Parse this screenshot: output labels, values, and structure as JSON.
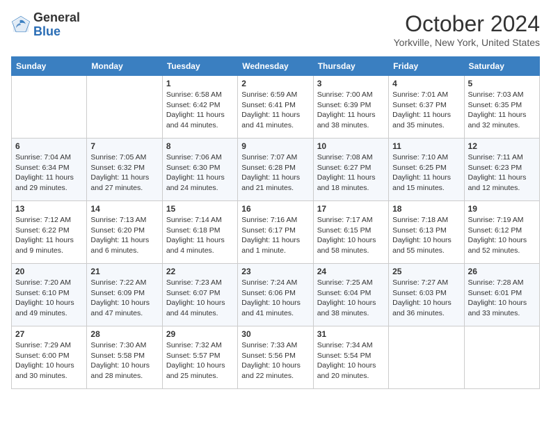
{
  "header": {
    "logo_general": "General",
    "logo_blue": "Blue",
    "month_year": "October 2024",
    "location": "Yorkville, New York, United States"
  },
  "days_of_week": [
    "Sunday",
    "Monday",
    "Tuesday",
    "Wednesday",
    "Thursday",
    "Friday",
    "Saturday"
  ],
  "weeks": [
    [
      {
        "day": "",
        "info": ""
      },
      {
        "day": "",
        "info": ""
      },
      {
        "day": "1",
        "info": "Sunrise: 6:58 AM\nSunset: 6:42 PM\nDaylight: 11 hours and 44 minutes."
      },
      {
        "day": "2",
        "info": "Sunrise: 6:59 AM\nSunset: 6:41 PM\nDaylight: 11 hours and 41 minutes."
      },
      {
        "day": "3",
        "info": "Sunrise: 7:00 AM\nSunset: 6:39 PM\nDaylight: 11 hours and 38 minutes."
      },
      {
        "day": "4",
        "info": "Sunrise: 7:01 AM\nSunset: 6:37 PM\nDaylight: 11 hours and 35 minutes."
      },
      {
        "day": "5",
        "info": "Sunrise: 7:03 AM\nSunset: 6:35 PM\nDaylight: 11 hours and 32 minutes."
      }
    ],
    [
      {
        "day": "6",
        "info": "Sunrise: 7:04 AM\nSunset: 6:34 PM\nDaylight: 11 hours and 29 minutes."
      },
      {
        "day": "7",
        "info": "Sunrise: 7:05 AM\nSunset: 6:32 PM\nDaylight: 11 hours and 27 minutes."
      },
      {
        "day": "8",
        "info": "Sunrise: 7:06 AM\nSunset: 6:30 PM\nDaylight: 11 hours and 24 minutes."
      },
      {
        "day": "9",
        "info": "Sunrise: 7:07 AM\nSunset: 6:28 PM\nDaylight: 11 hours and 21 minutes."
      },
      {
        "day": "10",
        "info": "Sunrise: 7:08 AM\nSunset: 6:27 PM\nDaylight: 11 hours and 18 minutes."
      },
      {
        "day": "11",
        "info": "Sunrise: 7:10 AM\nSunset: 6:25 PM\nDaylight: 11 hours and 15 minutes."
      },
      {
        "day": "12",
        "info": "Sunrise: 7:11 AM\nSunset: 6:23 PM\nDaylight: 11 hours and 12 minutes."
      }
    ],
    [
      {
        "day": "13",
        "info": "Sunrise: 7:12 AM\nSunset: 6:22 PM\nDaylight: 11 hours and 9 minutes."
      },
      {
        "day": "14",
        "info": "Sunrise: 7:13 AM\nSunset: 6:20 PM\nDaylight: 11 hours and 6 minutes."
      },
      {
        "day": "15",
        "info": "Sunrise: 7:14 AM\nSunset: 6:18 PM\nDaylight: 11 hours and 4 minutes."
      },
      {
        "day": "16",
        "info": "Sunrise: 7:16 AM\nSunset: 6:17 PM\nDaylight: 11 hours and 1 minute."
      },
      {
        "day": "17",
        "info": "Sunrise: 7:17 AM\nSunset: 6:15 PM\nDaylight: 10 hours and 58 minutes."
      },
      {
        "day": "18",
        "info": "Sunrise: 7:18 AM\nSunset: 6:13 PM\nDaylight: 10 hours and 55 minutes."
      },
      {
        "day": "19",
        "info": "Sunrise: 7:19 AM\nSunset: 6:12 PM\nDaylight: 10 hours and 52 minutes."
      }
    ],
    [
      {
        "day": "20",
        "info": "Sunrise: 7:20 AM\nSunset: 6:10 PM\nDaylight: 10 hours and 49 minutes."
      },
      {
        "day": "21",
        "info": "Sunrise: 7:22 AM\nSunset: 6:09 PM\nDaylight: 10 hours and 47 minutes."
      },
      {
        "day": "22",
        "info": "Sunrise: 7:23 AM\nSunset: 6:07 PM\nDaylight: 10 hours and 44 minutes."
      },
      {
        "day": "23",
        "info": "Sunrise: 7:24 AM\nSunset: 6:06 PM\nDaylight: 10 hours and 41 minutes."
      },
      {
        "day": "24",
        "info": "Sunrise: 7:25 AM\nSunset: 6:04 PM\nDaylight: 10 hours and 38 minutes."
      },
      {
        "day": "25",
        "info": "Sunrise: 7:27 AM\nSunset: 6:03 PM\nDaylight: 10 hours and 36 minutes."
      },
      {
        "day": "26",
        "info": "Sunrise: 7:28 AM\nSunset: 6:01 PM\nDaylight: 10 hours and 33 minutes."
      }
    ],
    [
      {
        "day": "27",
        "info": "Sunrise: 7:29 AM\nSunset: 6:00 PM\nDaylight: 10 hours and 30 minutes."
      },
      {
        "day": "28",
        "info": "Sunrise: 7:30 AM\nSunset: 5:58 PM\nDaylight: 10 hours and 28 minutes."
      },
      {
        "day": "29",
        "info": "Sunrise: 7:32 AM\nSunset: 5:57 PM\nDaylight: 10 hours and 25 minutes."
      },
      {
        "day": "30",
        "info": "Sunrise: 7:33 AM\nSunset: 5:56 PM\nDaylight: 10 hours and 22 minutes."
      },
      {
        "day": "31",
        "info": "Sunrise: 7:34 AM\nSunset: 5:54 PM\nDaylight: 10 hours and 20 minutes."
      },
      {
        "day": "",
        "info": ""
      },
      {
        "day": "",
        "info": ""
      }
    ]
  ]
}
